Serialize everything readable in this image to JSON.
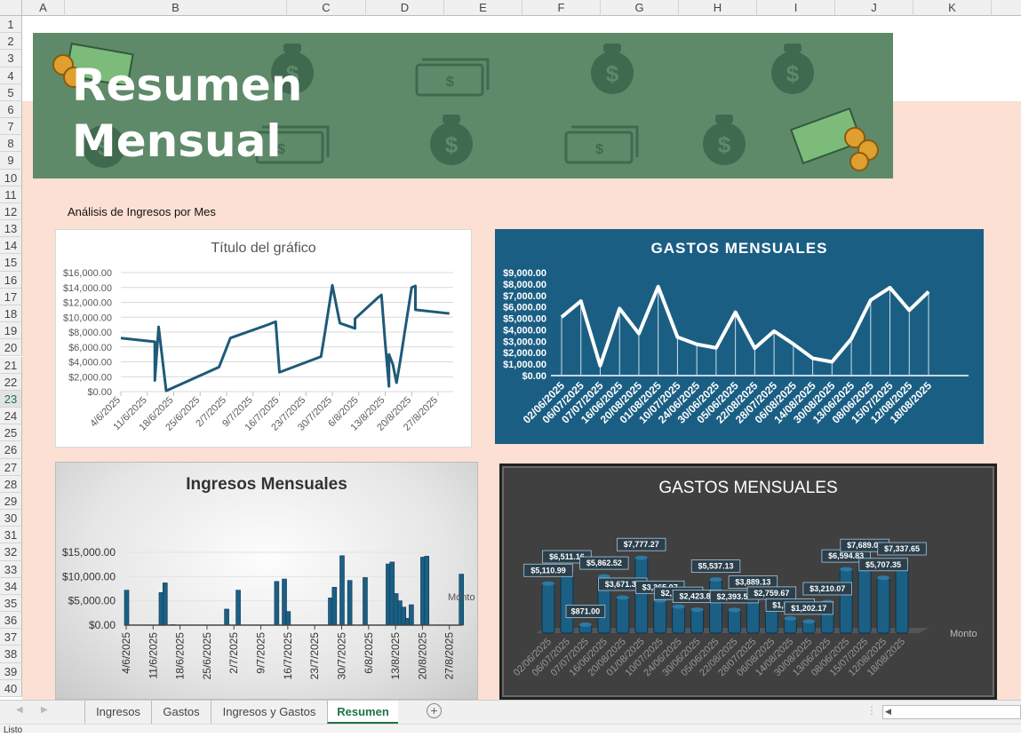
{
  "columns": [
    "A",
    "B",
    "C",
    "D",
    "E",
    "F",
    "G",
    "H",
    "I",
    "J",
    "K"
  ],
  "rows": [
    "1",
    "2",
    "3",
    "4",
    "5",
    "6",
    "7",
    "8",
    "9",
    "10",
    "11",
    "12",
    "13",
    "14",
    "15",
    "16",
    "17",
    "18",
    "19",
    "20",
    "21",
    "22",
    "23",
    "24",
    "25",
    "26",
    "27",
    "28",
    "29",
    "30",
    "31",
    "32",
    "33",
    "34",
    "35",
    "36",
    "37",
    "38",
    "39",
    "40"
  ],
  "selected_row": "23",
  "banner": {
    "line1": "Resumen",
    "line2": "Mensual"
  },
  "subtitle": "Análisis de Ingresos por Mes",
  "colors": {
    "green": "#5e8a6a",
    "peach": "#fbe0d3",
    "line": "#1f5a78",
    "blue_bg": "#1b5e83",
    "bar": "#1c5f84",
    "excel_green": "#217346"
  },
  "chart_data": [
    {
      "type": "line",
      "title": "Título del gráfico",
      "ylim": [
        0,
        16000
      ],
      "ystep": 2000,
      "xticks": [
        "4/6/2025",
        "11/6/2025",
        "18/6/2025",
        "25/6/2025",
        "2/7/2025",
        "9/7/2025",
        "16/7/2025",
        "23/7/2025",
        "30/7/2025",
        "6/8/2025",
        "13/8/2025",
        "20/8/2025",
        "27/8/2025"
      ],
      "x": [
        "4/6",
        "13/6",
        "13/6",
        "14/6",
        "16/6",
        "30/6",
        "3/7",
        "13/7",
        "15/7",
        "16/7",
        "27/7",
        "28/7",
        "30/7",
        "1/8",
        "5/8",
        "5/8",
        "11/8",
        "12/8",
        "13/8",
        "14/8",
        "14/8",
        "15/8",
        "16/8",
        "17/8",
        "20/8",
        "21/8",
        "21/8",
        "30/8"
      ],
      "values": [
        7200,
        6700,
        1500,
        8700,
        100,
        3300,
        7200,
        9000,
        9400,
        2600,
        4700,
        7800,
        14300,
        9200,
        8500,
        9800,
        12600,
        13000,
        6500,
        700,
        5000,
        3700,
        1200,
        4200,
        14000,
        14200,
        11000,
        10500
      ]
    },
    {
      "type": "line",
      "title": "GASTOS MENSUALES",
      "ylim": [
        0,
        9000
      ],
      "ystep": 1000,
      "categories": [
        "02/06/2025",
        "06/07/2025",
        "07/07/2025",
        "16/06/2025",
        "20/08/2025",
        "01/08/2025",
        "10/07/2025",
        "24/06/2025",
        "30/06/2025",
        "05/06/2025",
        "22/08/2025",
        "28/07/2025",
        "06/08/2025",
        "14/08/2025",
        "30/08/2025",
        "13/06/2025",
        "08/06/2025",
        "15/07/2025",
        "12/08/2025",
        "18/08/2025"
      ],
      "values": [
        5110.99,
        6511.16,
        871.0,
        5862.52,
        3671.38,
        7777.27,
        3365.07,
        2736.26,
        2423.87,
        5537.13,
        2393.54,
        3889.13,
        2759.67,
        1514.39,
        1202.17,
        3210.07,
        6594.83,
        7689.08,
        5707.35,
        7337.65
      ]
    },
    {
      "type": "bar",
      "title": "Ingresos Mensuales",
      "ylim": [
        0,
        15000
      ],
      "ystep": 5000,
      "legend": "Monto",
      "xticks": [
        "4/6/2025",
        "11/6/2025",
        "18/6/2025",
        "25/6/2025",
        "2/7/2025",
        "9/7/2025",
        "16/7/2025",
        "23/7/2025",
        "30/7/2025",
        "6/8/2025",
        "13/8/2025",
        "20/8/2025",
        "27/8/2025"
      ],
      "x": [
        "4/6",
        "13/6",
        "14/6",
        "16/6",
        "30/6",
        "3/7",
        "13/7",
        "15/7",
        "16/7",
        "27/7",
        "28/7",
        "30/7",
        "1/8",
        "5/8",
        "11/8",
        "12/8",
        "13/8",
        "14/8",
        "15/8",
        "16/8",
        "17/8",
        "20/8",
        "21/8",
        "30/8"
      ],
      "values": [
        7200,
        6700,
        8700,
        100,
        3300,
        7200,
        9000,
        9500,
        2800,
        5600,
        7800,
        14300,
        9200,
        9800,
        12600,
        13000,
        6500,
        5000,
        3700,
        1400,
        4200,
        14000,
        14200,
        10500
      ]
    },
    {
      "type": "bar",
      "title": "GASTOS MENSUALES",
      "legend": "Monto",
      "categories": [
        "02/06/2025",
        "06/07/2025",
        "07/07/2025",
        "16/06/2025",
        "20/08/2025",
        "01/08/2025",
        "10/07/2025",
        "24/06/2025",
        "30/06/2025",
        "05/06/2025",
        "22/08/2025",
        "28/07/2025",
        "06/08/2025",
        "14/08/2025",
        "30/08/2025",
        "13/06/2025",
        "08/06/2025",
        "15/07/2025",
        "12/08/2025",
        "18/08/2025"
      ],
      "values": [
        5110.99,
        6511.16,
        871.0,
        5862.52,
        3671.38,
        7777.27,
        3365.07,
        2736.26,
        2423.87,
        5537.13,
        2393.54,
        3889.13,
        2759.67,
        1514.39,
        1202.17,
        3210.07,
        6594.83,
        7689.08,
        5707.35,
        7337.65
      ],
      "labels": [
        "$5,110.99",
        "$6,511.16",
        "$871.00",
        "$5,862.52",
        "$3,671.38",
        "$7,777.27",
        "$3,365.07",
        "$2,736.26",
        "$2,423.87",
        "$5,537.13",
        "$2,393.54",
        "$3,889.13",
        "$2,759.67",
        "$1,514.39",
        "$1,202.17",
        "$3,210.07",
        "$6,594.83",
        "$7,689.08",
        "$5,707.35",
        "$7,337.65"
      ]
    }
  ],
  "tabs": [
    {
      "label": "Ingresos"
    },
    {
      "label": "Gastos"
    },
    {
      "label": "Ingresos y Gastos"
    },
    {
      "label": "Resumen",
      "active": true
    }
  ],
  "status": "Listo"
}
